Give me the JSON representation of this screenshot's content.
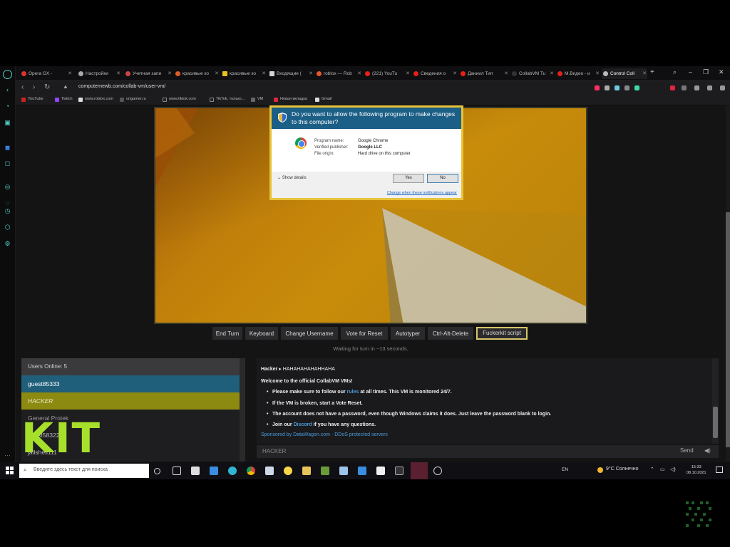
{
  "browser": {
    "tabs": [
      {
        "label": "Opera GX - "
      },
      {
        "label": "Настройки"
      },
      {
        "label": "Учетная запи"
      },
      {
        "label": "красивые ко"
      },
      {
        "label": "красивые ко"
      },
      {
        "label": "Входящие ("
      },
      {
        "label": "roblox — Rob"
      },
      {
        "label": "(221) YouTu"
      },
      {
        "label": "Сведения о"
      },
      {
        "label": "Даниил Тип"
      },
      {
        "label": "CollabVM Tu"
      },
      {
        "label": "M.Видео - и"
      },
      {
        "label": "Control Coll"
      }
    ],
    "new_tab": "+",
    "url": "computernewb.com/collab-vm/user-vm/",
    "bookmarks": [
      "YouTube",
      "Twitch",
      "www.roblox.com",
      "origamer.ru",
      "www.tiktok.com",
      "TikTok, только...",
      "VM",
      "Новая вкладка",
      "Gmail"
    ]
  },
  "uac": {
    "title": "Do you want to allow the following program to make changes to this computer?",
    "program_name_label": "Program name:",
    "program_name": "Google Chrome",
    "publisher_label": "Verified publisher:",
    "publisher": "Google LLC",
    "origin_label": "File origin:",
    "origin": "Hard drive on this computer",
    "show_details": "Show details",
    "yes": "Yes",
    "no": "No",
    "link": "Change when these notifications appear"
  },
  "vm_controls": [
    "End Turn",
    "Keyboard",
    "Change Username",
    "Vote for Reset",
    "Autotyper",
    "Ctrl-Alt-Delete",
    "Fuckerkit script"
  ],
  "turn_status": "Waiting for turn in ~13 seconds.",
  "users": {
    "header": "Users Online: 5",
    "list": [
      {
        "name": "guest85333",
        "color": "#1f5f7a"
      },
      {
        "name": "HACKER",
        "color": "#8c8a10"
      },
      {
        "name": "General Protek",
        "color": ""
      },
      {
        "name": "guest58322",
        "color": ""
      },
      {
        "name": "jailshell111",
        "color": ""
      }
    ]
  },
  "overlay_text": "KIT",
  "chat": {
    "msg_user": "Hacker",
    "msg_sep": " ▸ ",
    "msg_text": "HAHAHAHAHAHHAHA",
    "welcome": "Welcome to the official CollabVM VMs!",
    "rule1_a": "Please make sure to follow our ",
    "rule1_link": "rules",
    "rule1_b": " at all times. This VM is monitored 24/7.",
    "rule2": "If the VM is broken, start a Vote Reset.",
    "rule3": "The account does not have a password, even though Windows claims it does. Just leave the password blank to login.",
    "rule4_a": "Join our ",
    "rule4_link": "Discord",
    "rule4_b": " if you have any questions.",
    "sponsor": "Sponsored by DataWagon.com · DDoS protected servers",
    "input_user": "HACKER",
    "send": "Send"
  },
  "taskbar": {
    "search_placeholder": "Введите здесь текст для поиска",
    "lang": "EN",
    "weather": "9°C  Солнечно",
    "time": "15:33",
    "date": "08.10.2021"
  },
  "colors": {
    "uac_header": "#1b5e86",
    "uac_border": "#e8c33a",
    "highlight_user": "#8c8a10",
    "selected_user": "#1f5f7a",
    "overlay": "#a7e02a",
    "link": "#4a9bd8"
  }
}
